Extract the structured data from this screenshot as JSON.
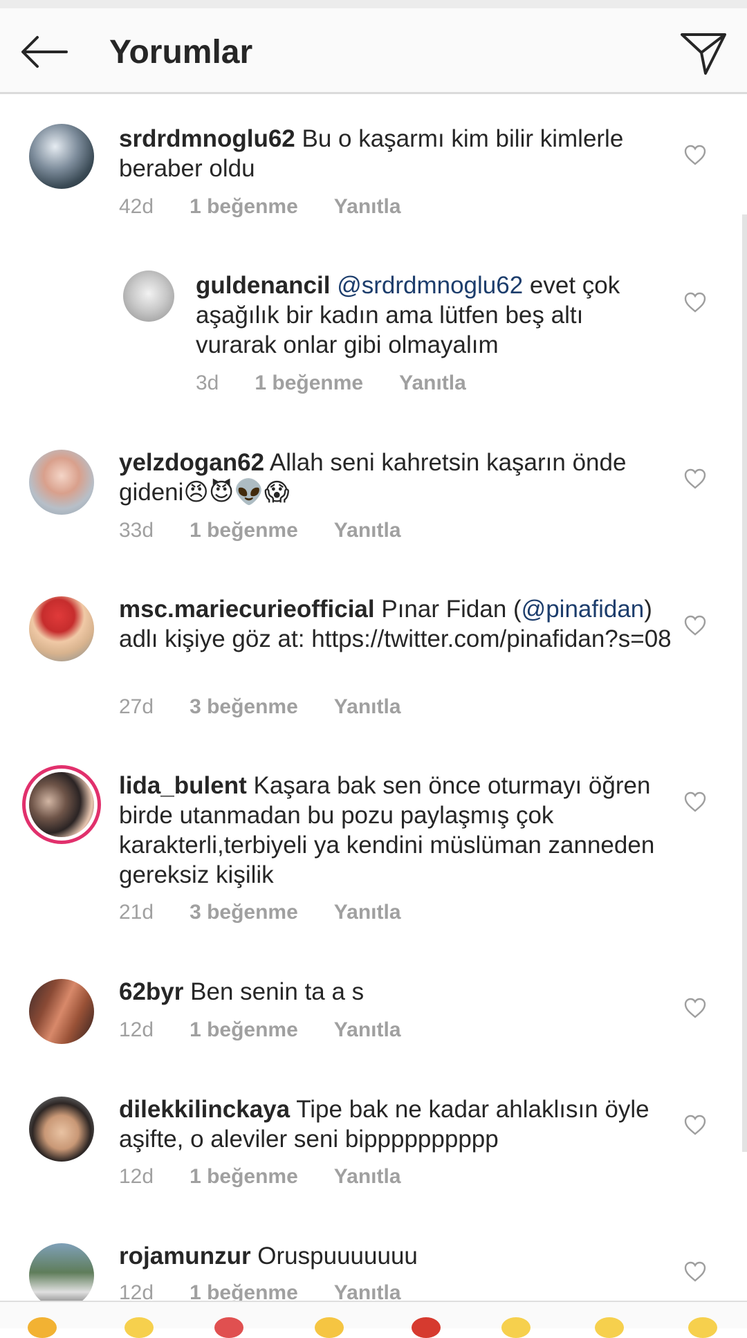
{
  "header": {
    "title": "Yorumlar",
    "back_icon": "arrow-left-icon",
    "share_icon": "paper-plane-icon"
  },
  "comments": [
    {
      "user": "srdrdmnoglu62",
      "pre": "",
      "mention": "",
      "text": " Bu o kaşarmı kim bilir kimlerle beraber oldu",
      "age": "42d",
      "likes": "1 beğenme",
      "reply": "Yanıtla"
    },
    {
      "user": "guldenancil",
      "pre": "",
      "mention": "@srdrdmnoglu62",
      "text": " evet çok aşağılık bir kadın ama lütfen beş altı vurarak onlar gibi olmayalım",
      "age": "3d",
      "likes": "1 beğenme",
      "reply": "Yanıtla"
    },
    {
      "user": "yelzdogan62",
      "pre": "",
      "mention": "",
      "text": " Allah seni kahretsin kaşarın önde gideni😠😈👽😱",
      "age": "33d",
      "likes": "1 beğenme",
      "reply": "Yanıtla"
    },
    {
      "user": "msc.mariecurieofficial",
      "pre": " Pınar Fidan (",
      "mention": "@pinafidan",
      "text": ") adlı kişiye göz at: https://twitter.com/pinafidan?s=08",
      "age": "27d",
      "likes": "3 beğenme",
      "reply": "Yanıtla"
    },
    {
      "user": "lida_bulent",
      "pre": "",
      "mention": "",
      "text": " Kaşara bak sen önce oturmayı öğren birde utanmadan bu pozu paylaşmış çok karakterli,terbiyeli ya kendini müslüman zanneden gereksiz kişilik",
      "age": "21d",
      "likes": "3 beğenme",
      "reply": "Yanıtla"
    },
    {
      "user": "62byr",
      "pre": "",
      "mention": "",
      "text": " Ben senin ta a s",
      "age": "12d",
      "likes": "1 beğenme",
      "reply": "Yanıtla"
    },
    {
      "user": "dilekkilinckaya",
      "pre": "",
      "mention": "",
      "text": " Tipe bak ne kadar ahlaklısın öyle aşifte, o aleviler seni bipppppppppp",
      "age": "12d",
      "likes": "1 beğenme",
      "reply": "Yanıtla"
    },
    {
      "user": "rojamunzur",
      "pre": "",
      "mention": "",
      "text": " Oruspuuuuuuu",
      "age": "12d",
      "likes": "1 beğenme",
      "reply": "Yanıtla"
    }
  ],
  "colors": {
    "text": "#262626",
    "meta": "#a0a0a0",
    "mention": "#1c3d6c",
    "story_ring": "#e1306c"
  }
}
